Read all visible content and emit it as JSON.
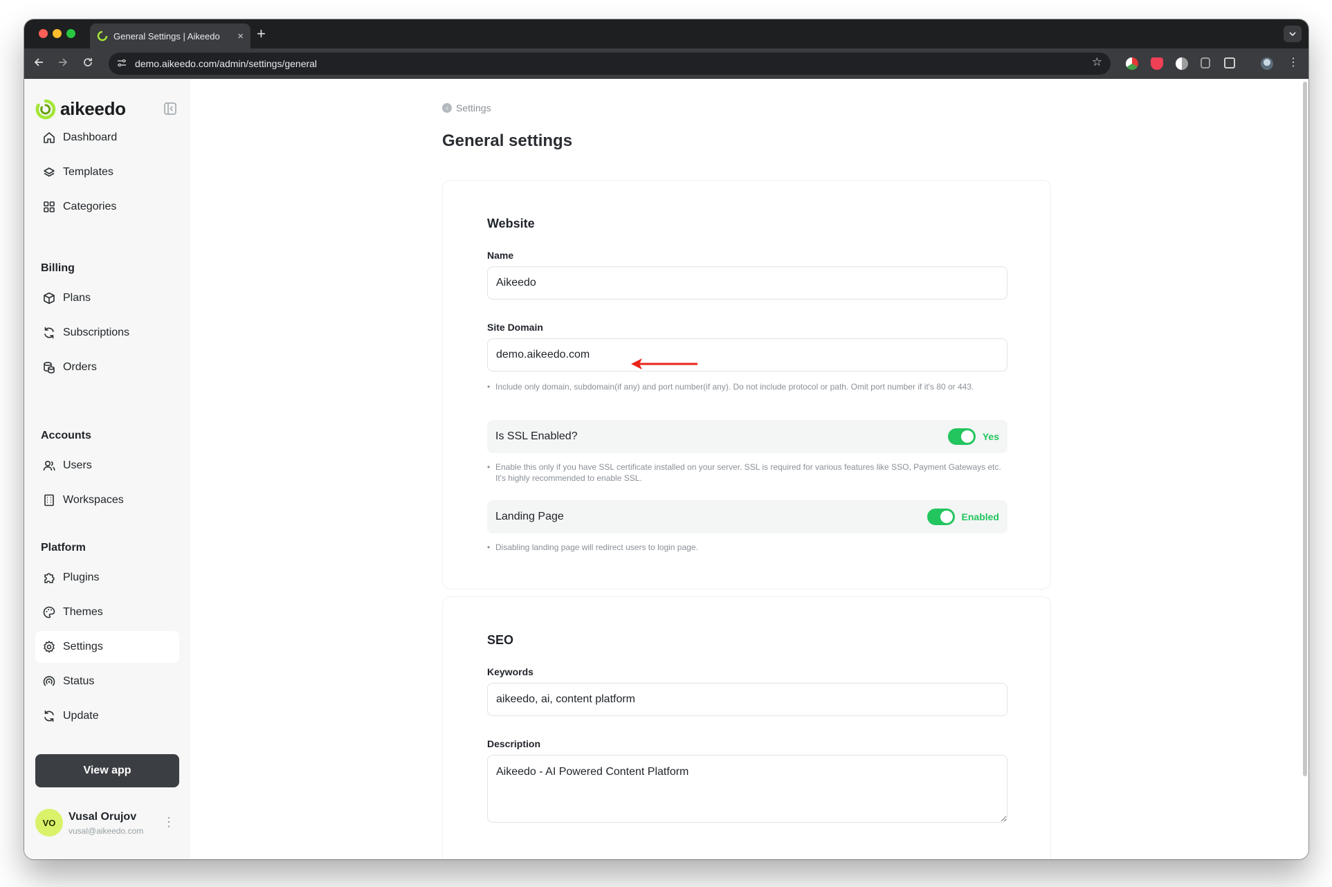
{
  "browser": {
    "tab_title": "General Settings | Aikeedo",
    "url": "demo.aikeedo.com/admin/settings/general",
    "tab_close": "×",
    "new_tab": "+"
  },
  "sidebar": {
    "logo": "aikeedo",
    "items_top": [
      {
        "label": "Dashboard",
        "icon": "home-icon"
      },
      {
        "label": "Templates",
        "icon": "layers-icon"
      },
      {
        "label": "Categories",
        "icon": "grid-icon"
      }
    ],
    "billing": {
      "heading": "Billing",
      "items": [
        {
          "label": "Plans",
          "icon": "box-icon"
        },
        {
          "label": "Subscriptions",
          "icon": "refresh-icon"
        },
        {
          "label": "Orders",
          "icon": "coins-icon"
        }
      ]
    },
    "accounts": {
      "heading": "Accounts",
      "items": [
        {
          "label": "Users",
          "icon": "users-icon"
        },
        {
          "label": "Workspaces",
          "icon": "building-icon"
        }
      ]
    },
    "platform": {
      "heading": "Platform",
      "items": [
        {
          "label": "Plugins",
          "icon": "puzzle-icon"
        },
        {
          "label": "Themes",
          "icon": "palette-icon"
        },
        {
          "label": "Settings",
          "icon": "gear-icon",
          "active": true
        },
        {
          "label": "Status",
          "icon": "status-icon"
        },
        {
          "label": "Update",
          "icon": "update-icon"
        }
      ]
    },
    "view_app": "View app",
    "user": {
      "initials": "VO",
      "name": "Vusal Orujov",
      "email": "vusal@aikeedo.com"
    }
  },
  "main": {
    "breadcrumb": "Settings",
    "title": "General settings",
    "website": {
      "title": "Website",
      "name_label": "Name",
      "name_value": "Aikeedo",
      "domain_label": "Site Domain",
      "domain_value": "demo.aikeedo.com",
      "domain_hint": "Include only domain, subdomain(if any) and port number(if any). Do not include protocol or path. Omit port number if it's 80 or 443.",
      "ssl_label": "Is SSL Enabled?",
      "ssl_state": "Yes",
      "ssl_hint": "Enable this only if you have SSL certificate installed on your server. SSL is required for various features like SSO, Payment Gateways etc. It's highly recommended to enable SSL.",
      "landing_label": "Landing Page",
      "landing_state": "Enabled",
      "landing_hint": "Disabling landing page will redirect users to login page."
    },
    "seo": {
      "title": "SEO",
      "keywords_label": "Keywords",
      "keywords_value": "aikeedo, ai, content platform",
      "description_label": "Description",
      "description_value": "Aikeedo - AI Powered Content Platform"
    }
  },
  "colors": {
    "accent": "#22c55e",
    "annotation_arrow": "#e8261a",
    "sidebar_bg": "#f6f7f6",
    "view_app_bg": "#3b3e42"
  }
}
